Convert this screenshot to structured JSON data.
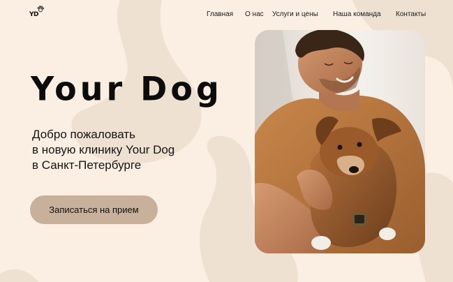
{
  "header": {
    "logo_text": "YD",
    "logo_icon": "paw-icon",
    "nav": [
      {
        "label": "Главная"
      },
      {
        "label": "О нас"
      },
      {
        "label": "Услуги и цены"
      },
      {
        "label": "Наша команда"
      },
      {
        "label": "Контакты"
      }
    ]
  },
  "hero": {
    "brand": "Your Dog",
    "welcome_lines": [
      "Добро пожаловать",
      "в новую клинику Your Dog",
      "в Санкт-Петербурге"
    ],
    "cta_label": "Записаться на прием",
    "photo_icon": "man-with-puppy-photo"
  },
  "colors": {
    "background": "#fbeee2",
    "blob": "#efe1d3",
    "button": "#c8b09a",
    "text": "#111111"
  }
}
